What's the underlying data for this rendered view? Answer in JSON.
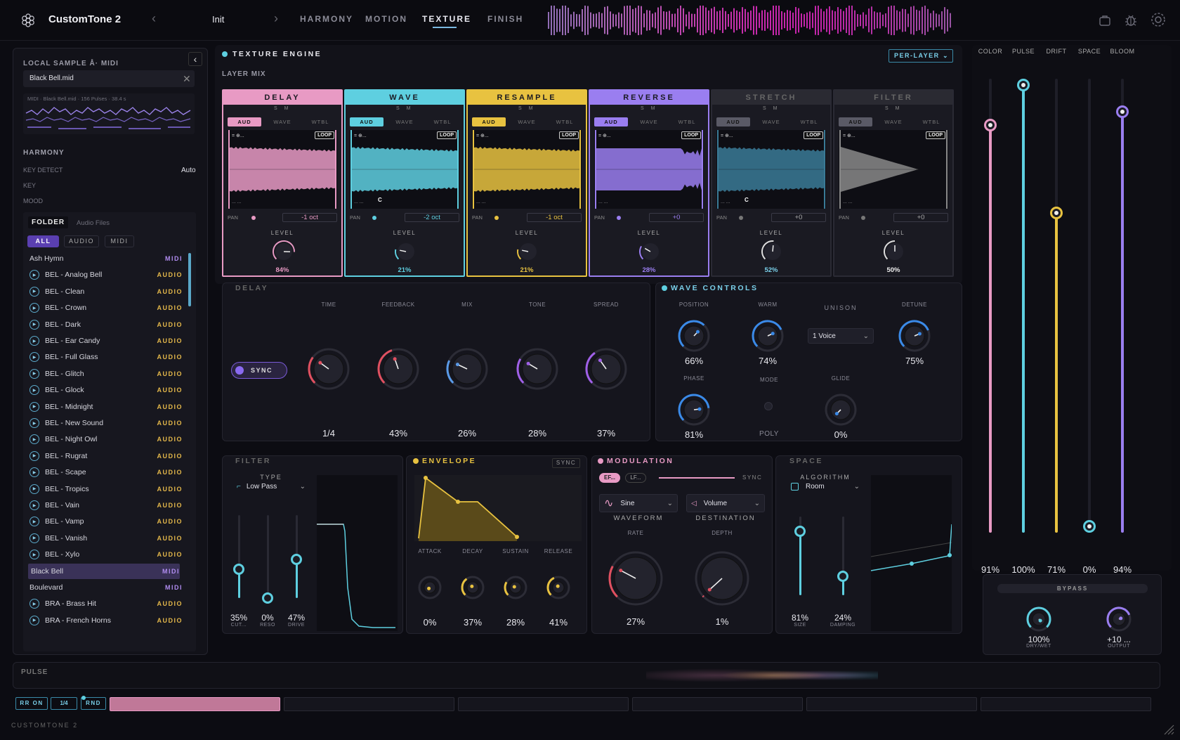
{
  "app": {
    "title": "CustomTone 2",
    "preset": "Init",
    "footer": "CUSTOMTONE 2"
  },
  "nav": {
    "tabs": [
      "HARMONY",
      "MOTION",
      "TEXTURE",
      "FINISH"
    ],
    "active": "TEXTURE"
  },
  "left": {
    "local_title": "LOCAL SAMPLE  Å·  MIDI",
    "file": "Black Bell.mid",
    "midi_info": "MIDI · Black Bell.mid · 156 Pulses · 38.4 s",
    "harmony": {
      "title": "HARMONY",
      "key_detect_label": "KEY DETECT",
      "key_detect_value": "Auto",
      "key_label": "KEY",
      "mood_label": "MOOD"
    },
    "browser": {
      "tab_folder": "FOLDER",
      "tab_audio": "Audio Files",
      "filters": [
        "ALL",
        "AUDIO",
        "MIDI"
      ],
      "items": [
        {
          "name": "Ash Hymn",
          "type": "MIDI",
          "play": false
        },
        {
          "name": "BEL - Analog Bell",
          "type": "AUDIO",
          "play": true
        },
        {
          "name": "BEL - Clean",
          "type": "AUDIO",
          "play": true
        },
        {
          "name": "BEL - Crown",
          "type": "AUDIO",
          "play": true
        },
        {
          "name": "BEL - Dark",
          "type": "AUDIO",
          "play": true
        },
        {
          "name": "BEL - Ear Candy",
          "type": "AUDIO",
          "play": true
        },
        {
          "name": "BEL - Full Glass",
          "type": "AUDIO",
          "play": true
        },
        {
          "name": "BEL - Glitch",
          "type": "AUDIO",
          "play": true
        },
        {
          "name": "BEL - Glock",
          "type": "AUDIO",
          "play": true
        },
        {
          "name": "BEL - Midnight",
          "type": "AUDIO",
          "play": true
        },
        {
          "name": "BEL - New Sound",
          "type": "AUDIO",
          "play": true
        },
        {
          "name": "BEL - Night Owl",
          "type": "AUDIO",
          "play": true
        },
        {
          "name": "BEL - Rugrat",
          "type": "AUDIO",
          "play": true
        },
        {
          "name": "BEL - Scape",
          "type": "AUDIO",
          "play": true
        },
        {
          "name": "BEL - Tropics",
          "type": "AUDIO",
          "play": true
        },
        {
          "name": "BEL - Vain",
          "type": "AUDIO",
          "play": true
        },
        {
          "name": "BEL - Vamp",
          "type": "AUDIO",
          "play": true
        },
        {
          "name": "BEL - Vanish",
          "type": "AUDIO",
          "play": true
        },
        {
          "name": "BEL - Xylo",
          "type": "AUDIO",
          "play": true
        },
        {
          "name": "Black Bell",
          "type": "MIDI",
          "play": false,
          "selected": true
        },
        {
          "name": "Boulevard",
          "type": "MIDI",
          "play": false
        },
        {
          "name": "BRA - Brass Hit",
          "type": "AUDIO",
          "play": true
        },
        {
          "name": "BRA - French Horns",
          "type": "AUDIO",
          "play": true
        }
      ]
    }
  },
  "engine": {
    "title": "TEXTURE ENGINE",
    "per_layer": "PER-LAYER",
    "layer_mix": "LAYER MIX",
    "layers": [
      {
        "name": "DELAY",
        "color": "#e89ac4",
        "active": true,
        "oct": "-1 oct",
        "level": "84%",
        "note": ""
      },
      {
        "name": "WAVE",
        "color": "#5ecfe0",
        "active": true,
        "oct": "-2 oct",
        "level": "21%",
        "note": "C"
      },
      {
        "name": "RESAMPLE",
        "color": "#e8c240",
        "active": true,
        "oct": "-1 oct",
        "level": "21%",
        "note": ""
      },
      {
        "name": "REVERSE",
        "color": "#9a7ef0",
        "active": true,
        "oct": "+0",
        "level": "28%",
        "note": ""
      },
      {
        "name": "STRETCH",
        "color": "#4a8aa8",
        "active": false,
        "oct": "+0",
        "level": "52%",
        "note": "C"
      },
      {
        "name": "FILTER",
        "color": "#bcbcbc",
        "active": false,
        "oct": "+0",
        "level": "50%",
        "note": ""
      }
    ],
    "mode_labels": [
      "AUD",
      "WAVE",
      "WTBL"
    ],
    "loop": "LOOP",
    "pan": "PAN",
    "level_label": "LEVEL",
    "s": "S",
    "m": "M",
    "c": "C"
  },
  "delay": {
    "title": "DELAY",
    "sync": "SYNC",
    "labels": [
      "TIME",
      "FEEDBACK",
      "MIX",
      "TONE",
      "SPREAD"
    ],
    "values": [
      "1/4",
      "43%",
      "26%",
      "28%",
      "37%"
    ]
  },
  "wave_controls": {
    "title": "WAVE CONTROLS",
    "position": {
      "label": "POSITION",
      "value": "66%"
    },
    "warm": {
      "label": "WARM",
      "value": "74%"
    },
    "unison": {
      "label": "UNISON",
      "value": "1 Voice"
    },
    "detune": {
      "label": "DETUNE",
      "value": "75%"
    },
    "phase": {
      "label": "PHASE",
      "value": "81%"
    },
    "mode": {
      "label": "MODE",
      "value": "POLY"
    },
    "glide": {
      "label": "GLIDE",
      "value": "0%"
    }
  },
  "filter": {
    "title": "FILTER",
    "type_label": "TYPE",
    "type": "Low Pass",
    "values": [
      "35%",
      "0%",
      "47%"
    ],
    "labels": [
      "CUT...",
      "RESO",
      "DRIVE"
    ]
  },
  "envelope": {
    "title": "ENVELOPE",
    "sync": "SYNC",
    "labels": [
      "ATTACK",
      "DECAY",
      "SUSTAIN",
      "RELEASE"
    ],
    "values": [
      "0%",
      "37%",
      "28%",
      "41%"
    ]
  },
  "modulation": {
    "title": "MODULATION",
    "tabs": [
      "EF...",
      "LF..."
    ],
    "sync": "SYNC",
    "waveform": "Sine",
    "waveform_label": "WAVEFORM",
    "destination": "Volume",
    "destination_label": "DESTINATION",
    "rate_label": "RATE",
    "depth_label": "DEPTH",
    "rate": "27%",
    "depth": "1%"
  },
  "space": {
    "title": "SPACE",
    "algo_label": "ALGORITHM",
    "algo": "Room",
    "values": [
      "81%",
      "24%"
    ],
    "labels": [
      "SIZE",
      "DAMPING"
    ]
  },
  "macros": {
    "labels": [
      "COLOR",
      "PULSE",
      "DRIFT",
      "SPACE",
      "BLOOM"
    ],
    "values": [
      "91%",
      "100%",
      "71%",
      "0%",
      "94%"
    ],
    "fractions": [
      0.91,
      1.0,
      0.71,
      0.0,
      0.94
    ],
    "colors": [
      "#e89ac4",
      "#5ecfe0",
      "#e8c240",
      "#5ecfe0",
      "#9a7ef0"
    ]
  },
  "bypass": {
    "title": "BYPASS",
    "drywet": "100%",
    "drywet_label": "DRY/WET",
    "output": "+10 ...",
    "output_label": "OUTPUT"
  },
  "pulse": {
    "title": "PULSE",
    "rr": "RR  ON",
    "rate": "1/4",
    "rnd": "RND"
  }
}
